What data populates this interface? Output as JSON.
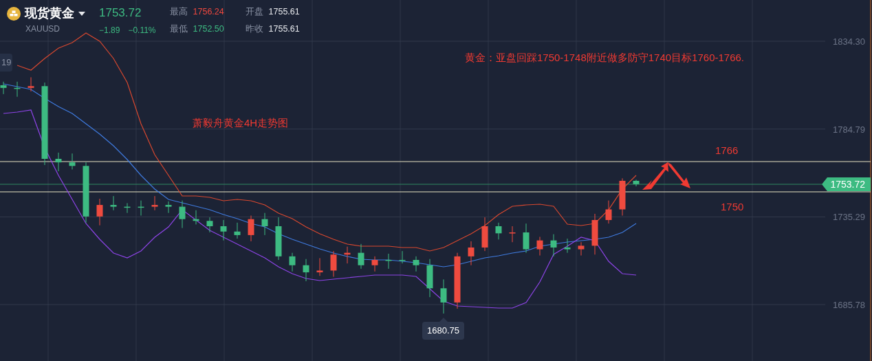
{
  "header": {
    "title": "现货黄金",
    "symbol": "XAUUSD",
    "price": "1753.72",
    "change": "−1.89",
    "change_pct": "−0.11%",
    "stats": [
      {
        "label": "最高",
        "value": "1756.24",
        "color": "#f0483e"
      },
      {
        "label": "开盘",
        "value": "1755.61",
        "color": "#e8eaee"
      },
      {
        "label": "最低",
        "value": "1752.50",
        "color": "#3dbb82"
      },
      {
        "label": "昨收",
        "value": "1755.61",
        "color": "#e8eaee"
      }
    ]
  },
  "chart": {
    "price_axis": [
      "1834.30",
      "1784.79",
      "1735.29",
      "1685.78"
    ],
    "price_tag": "1753.72",
    "low_tag": "1680.75",
    "edge_tag": "19",
    "notes": [
      "萧毅舟黄金4H走势图",
      "黄金：亚盘回踩1750-1748附近做多防守1740目标1760-1766.",
      "1766",
      "1750"
    ]
  }
}
